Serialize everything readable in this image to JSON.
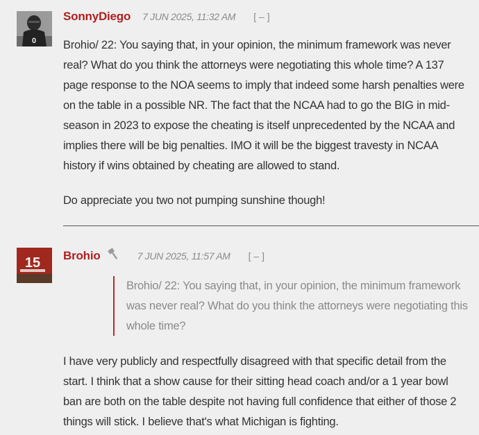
{
  "comments": [
    {
      "author": "SonnyDiego",
      "timestamp": "7 JUN 2025, 11:32 AM",
      "collapse": "[ – ]",
      "avatar_jersey_number": "0",
      "paragraphs": [
        "Brohio/ 22:  You saying that, in your opinion, the minimum framework was never real?  What do you think the attorneys were negotiating this whole time?   A 137 page response to the NOA seems to imply that indeed some harsh penalties were on the table in a possible NR.  The fact that the NCAA had to go the BIG in mid-season in 2023 to expose the cheating is itself unprecedented by the NCAA and implies there will be big penalties.   IMO it will be the biggest travesty in NCAA history if wins obtained by cheating are allowed to stand.",
        "Do appreciate you two not pumping sunshine though!"
      ]
    },
    {
      "author": "Brohio",
      "timestamp": "7 JUN 2025, 11:57 AM",
      "collapse": "[ – ]",
      "avatar_jersey_number": "15",
      "badge_icon": "gavel-icon",
      "quote": "Brohio/ 22:  You saying that, in your opinion, the minimum framework was never real?  What do you think the attorneys were negotiating this whole time?",
      "paragraphs": [
        "I have very publicly and respectfully disagreed with that specific detail from the start. I think that a show cause for their sitting head coach and/or a 1 year bowl ban are both on the table despite not having full confidence that either of those 2 things will stick. I believe that's what Michigan is fighting."
      ]
    }
  ],
  "colors": {
    "background": "#efefef",
    "author": "#b01f1f",
    "quote_border": "#c0262b",
    "muted": "#8a8a8a",
    "text": "#333333"
  }
}
